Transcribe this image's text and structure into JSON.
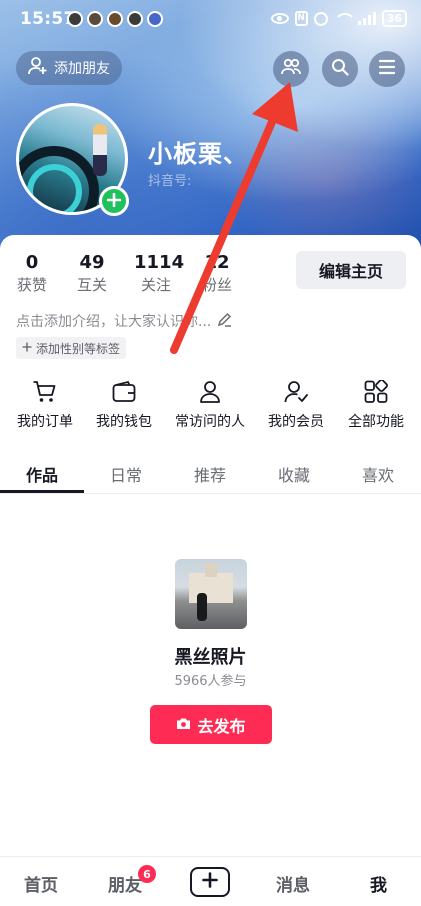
{
  "status_bar": {
    "time": "15:57",
    "battery": "36"
  },
  "header": {
    "add_friend_label": "添加朋友",
    "nickname": "小板栗、",
    "douyin_id_label": "抖音号:"
  },
  "stats": [
    {
      "value": "0",
      "label": "获赞"
    },
    {
      "value": "49",
      "label": "互关"
    },
    {
      "value": "1114",
      "label": "关注"
    },
    {
      "value": "12",
      "label": "粉丝"
    }
  ],
  "edit_profile_label": "编辑主页",
  "intro_placeholder": "点击添加介绍，让大家认识你...",
  "tag_button_label": "添加性别等标签",
  "functions": [
    {
      "label": "我的订单",
      "icon": "cart-icon"
    },
    {
      "label": "我的钱包",
      "icon": "wallet-icon"
    },
    {
      "label": "常访问的人",
      "icon": "person-icon"
    },
    {
      "label": "我的会员",
      "icon": "member-icon"
    },
    {
      "label": "全部功能",
      "icon": "grid-icon"
    }
  ],
  "tabs": [
    "作品",
    "日常",
    "推荐",
    "收藏",
    "喜欢"
  ],
  "promo": {
    "title": "黑丝照片",
    "participants": "5966人参与",
    "button_label": "去发布"
  },
  "bottom_nav": {
    "home": "首页",
    "friends": "朋友",
    "friends_badge": "6",
    "messages": "消息",
    "me": "我"
  },
  "colors": {
    "accent": "#fe2c55",
    "online_plus": "#20c05c",
    "annotation_arrow": "#ee3b2f"
  }
}
